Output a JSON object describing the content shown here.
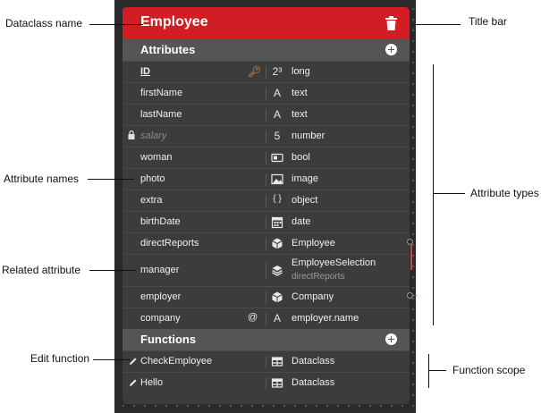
{
  "dataclass": {
    "name": "Employee",
    "accent_color": "#d31d24"
  },
  "attributes_section": {
    "label": "Attributes"
  },
  "attributes": [
    {
      "name": "ID",
      "type": "long",
      "type_icon": "2³",
      "marker": "key"
    },
    {
      "name": "firstName",
      "type": "text",
      "type_icon": "A"
    },
    {
      "name": "lastName",
      "type": "text",
      "type_icon": "A"
    },
    {
      "name": "salary",
      "type": "number",
      "type_icon": "5",
      "marker": "lock"
    },
    {
      "name": "woman",
      "type": "bool",
      "type_icon": "bool"
    },
    {
      "name": "photo",
      "type": "image",
      "type_icon": "image"
    },
    {
      "name": "extra",
      "type": "object",
      "type_icon": "{ }"
    },
    {
      "name": "birthDate",
      "type": "date",
      "type_icon": "calendar"
    },
    {
      "name": "directReports",
      "type": "Employee",
      "type_icon": "cube"
    },
    {
      "name": "manager",
      "type": "EmployeeSelection",
      "type_sub": "directReports",
      "type_icon": "layers"
    },
    {
      "name": "employer",
      "type": "Company",
      "type_icon": "cube"
    },
    {
      "name": "company",
      "type": "employer.name",
      "type_icon": "A",
      "marker": "@"
    }
  ],
  "functions_section": {
    "label": "Functions"
  },
  "functions": [
    {
      "name": "CheckEmployee",
      "scope": "Dataclass"
    },
    {
      "name": "Hello",
      "scope": "Dataclass"
    }
  ],
  "annotations": {
    "dataclass_name": "Dataclass name",
    "title_bar": "Title bar",
    "attribute_names": "Attribute names",
    "attribute_types": "Attribute types",
    "related_attribute": "Related attribute",
    "edit_function": "Edit function",
    "function_scope": "Function scope"
  }
}
